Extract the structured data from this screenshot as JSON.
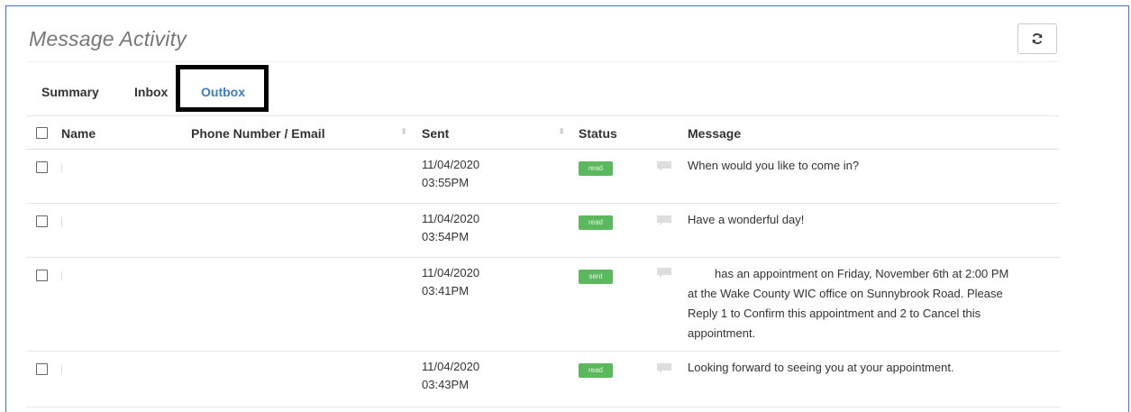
{
  "panel": {
    "title": "Message Activity"
  },
  "tabs": [
    {
      "label": "Summary",
      "active": false
    },
    {
      "label": "Inbox",
      "active": false
    },
    {
      "label": "Outbox",
      "active": true
    }
  ],
  "table": {
    "headers": {
      "name": "Name",
      "contact": "Phone Number / Email",
      "sent": "Sent",
      "status": "Status",
      "message": "Message"
    },
    "rows": [
      {
        "date": "11/04/2020",
        "time": "03:55PM",
        "status": "read",
        "message": "When would you like to come in?"
      },
      {
        "date": "11/04/2020",
        "time": "03:54PM",
        "status": "read",
        "message": "Have a wonderful day!"
      },
      {
        "date": "11/04/2020",
        "time": "03:41PM",
        "status": "sent",
        "message_lines": [
          "has an appointment on Friday, November 6th at 2:00 PM",
          "at the Wake County WIC office on Sunnybrook Road. Please",
          "Reply 1 to Confirm this appointment and 2 to Cancel this",
          "appointment."
        ]
      },
      {
        "date": "11/04/2020",
        "time": "03:43PM",
        "status": "read",
        "message": "Looking forward to seeing you at your appointment."
      }
    ]
  },
  "colors": {
    "accent": "#3a7ec7",
    "badge": "#5cb85c",
    "frame": "#4a72c4"
  },
  "icons": {
    "refresh": "refresh-icon",
    "message": "speech-bubble-icon",
    "sort": "sort-icon"
  }
}
